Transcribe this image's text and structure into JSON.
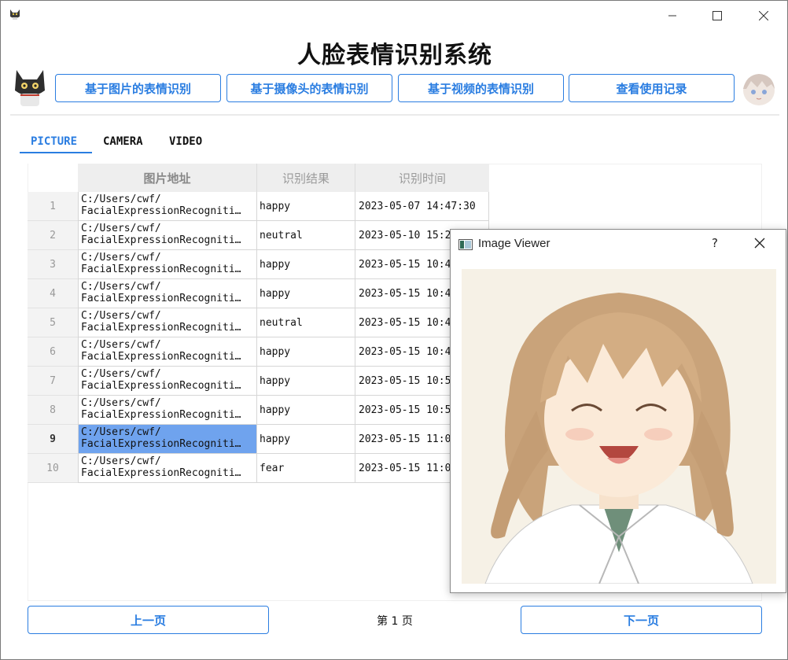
{
  "window": {
    "title": "人脸表情识别系统",
    "controls": [
      "minimize",
      "maximize",
      "close"
    ]
  },
  "toolbar": {
    "buttons": [
      {
        "label": "基于图片的表情识别"
      },
      {
        "label": "基于摄像头的表情识别"
      },
      {
        "label": "基于视频的表情识别"
      },
      {
        "label": "查看使用记录"
      }
    ]
  },
  "tabs": [
    {
      "label": "PICTURE",
      "active": true
    },
    {
      "label": "CAMERA",
      "active": false
    },
    {
      "label": "VIDEO",
      "active": false
    }
  ],
  "table": {
    "columns": [
      "图片地址",
      "识别结果",
      "识别时间"
    ],
    "rows": [
      {
        "num": "1",
        "path1": "C:/Users/cwf/",
        "path2": "FacialExpressionRecogniti…",
        "result": "happy",
        "time": "2023-05-07 14:47:30"
      },
      {
        "num": "2",
        "path1": "C:/Users/cwf/",
        "path2": "FacialExpressionRecogniti…",
        "result": "neutral",
        "time": "2023-05-10 15:2"
      },
      {
        "num": "3",
        "path1": "C:/Users/cwf/",
        "path2": "FacialExpressionRecogniti…",
        "result": "happy",
        "time": "2023-05-15 10:4"
      },
      {
        "num": "4",
        "path1": "C:/Users/cwf/",
        "path2": "FacialExpressionRecogniti…",
        "result": "happy",
        "time": "2023-05-15 10:4"
      },
      {
        "num": "5",
        "path1": "C:/Users/cwf/",
        "path2": "FacialExpressionRecogniti…",
        "result": "neutral",
        "time": "2023-05-15 10:4"
      },
      {
        "num": "6",
        "path1": "C:/Users/cwf/",
        "path2": "FacialExpressionRecogniti…",
        "result": "happy",
        "time": "2023-05-15 10:4"
      },
      {
        "num": "7",
        "path1": "C:/Users/cwf/",
        "path2": "FacialExpressionRecogniti…",
        "result": "happy",
        "time": "2023-05-15 10:5"
      },
      {
        "num": "8",
        "path1": "C:/Users/cwf/",
        "path2": "FacialExpressionRecogniti…",
        "result": "happy",
        "time": "2023-05-15 10:5"
      },
      {
        "num": "9",
        "path1": "C:/Users/cwf/",
        "path2": "FacialExpressionRecogniti…",
        "result": "happy",
        "time": "2023-05-15 11:0",
        "selected": true
      },
      {
        "num": "10",
        "path1": "C:/Users/cwf/",
        "path2": "FacialExpressionRecogniti…",
        "result": "fear",
        "time": "2023-05-15 11:0"
      }
    ]
  },
  "pagination": {
    "prev_label": "上一页",
    "page_text": "第 1 页",
    "next_label": "下一页"
  },
  "viewer": {
    "title": "Image Viewer",
    "help_label": "?"
  },
  "colors": {
    "accent": "#2a7de1",
    "selection": "#6fa3ee"
  }
}
